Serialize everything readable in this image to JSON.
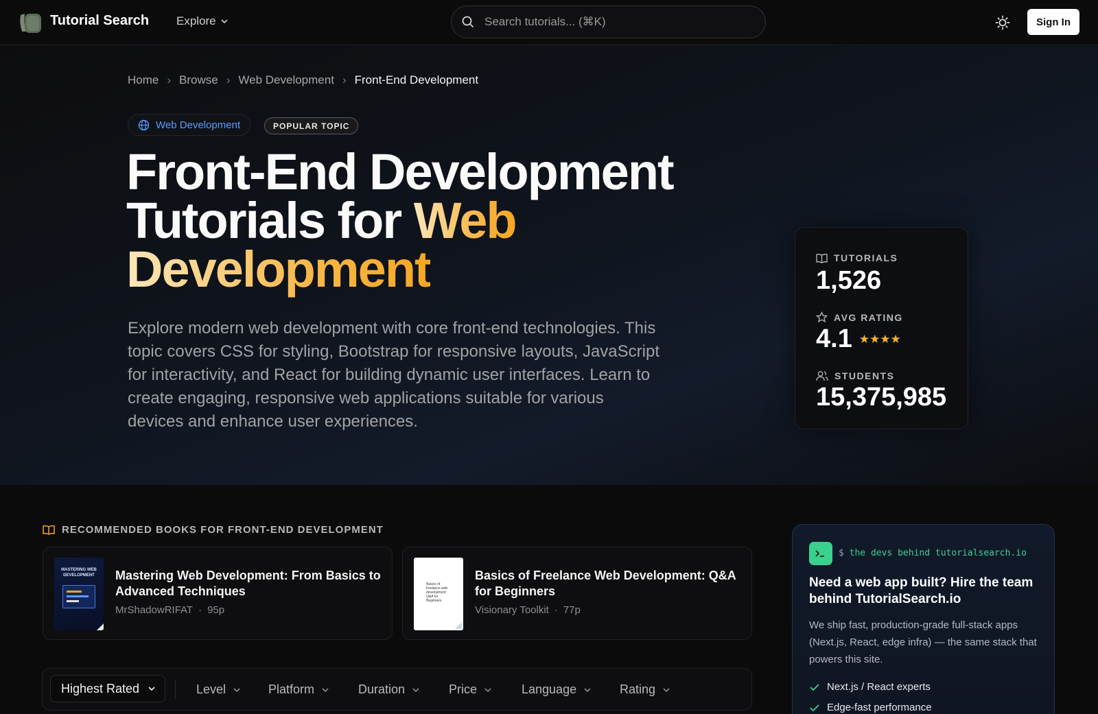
{
  "nav": {
    "brand": "Tutorial Search",
    "explore_label": "Explore",
    "search_placeholder": "Search tutorials... (⌘K)",
    "signin_label": "Sign In"
  },
  "breadcrumb": {
    "items": [
      "Home",
      "Browse",
      "Web Development"
    ],
    "current": "Front-End Development"
  },
  "hero": {
    "category": "Web Development",
    "badge": "POPULAR TOPIC",
    "title_line1": "Front-End Development",
    "title_line2_plain": "Tutorials for ",
    "title_line2_accent": "Web",
    "title_line3_accent": "Development",
    "description": "Explore modern web development with core front-end technologies. This topic covers CSS for styling, Bootstrap for responsive layouts, JavaScript for interactivity, and React for building dynamic user interfaces. Learn to create engaging, responsive web applications suitable for various devices and enhance user experiences."
  },
  "stats": {
    "tutorials_label": "TUTORIALS",
    "tutorials_value": "1,526",
    "rating_label": "AVG RATING",
    "rating_value": "4.1",
    "rating_stars": 4,
    "students_label": "STUDENTS",
    "students_value": "15,375,985"
  },
  "books": {
    "heading": "RECOMMENDED BOOKS FOR FRONT-END DEVELOPMENT",
    "items": [
      {
        "title": "Mastering Web Development: From Basics to Advanced Techniques",
        "author": "MrShadowRIFAT",
        "sep": "·",
        "pages": "95p",
        "cover_title": "MASTERING WEB DEVELOPMENT"
      },
      {
        "title": "Basics of Freelance Web Development: Q&A for Beginners",
        "author": "Visionary Toolkit",
        "sep": "·",
        "pages": "77p",
        "cover_title": "Basics of freelance web development: Q&A for Beginners"
      }
    ]
  },
  "filters": {
    "sort_label": "Highest Rated",
    "items": [
      "Level",
      "Platform",
      "Duration",
      "Price",
      "Language",
      "Rating"
    ]
  },
  "promo": {
    "prompt": "$ ",
    "terminal_text": "the devs behind tutorialsearch.io",
    "title": "Need a web app built? Hire the team behind TutorialSearch.io",
    "description": "We ship fast, production-grade full-stack apps (Next.js, React, edge infra) — the same stack that powers this site.",
    "checks": [
      "Next.js / React experts",
      "Edge-fast performance"
    ]
  },
  "colors": {
    "accent_blue": "#5b9bff",
    "accent_gold": "#f5a623",
    "star": "#f5b32b",
    "terminal_green": "#3ad18f"
  }
}
